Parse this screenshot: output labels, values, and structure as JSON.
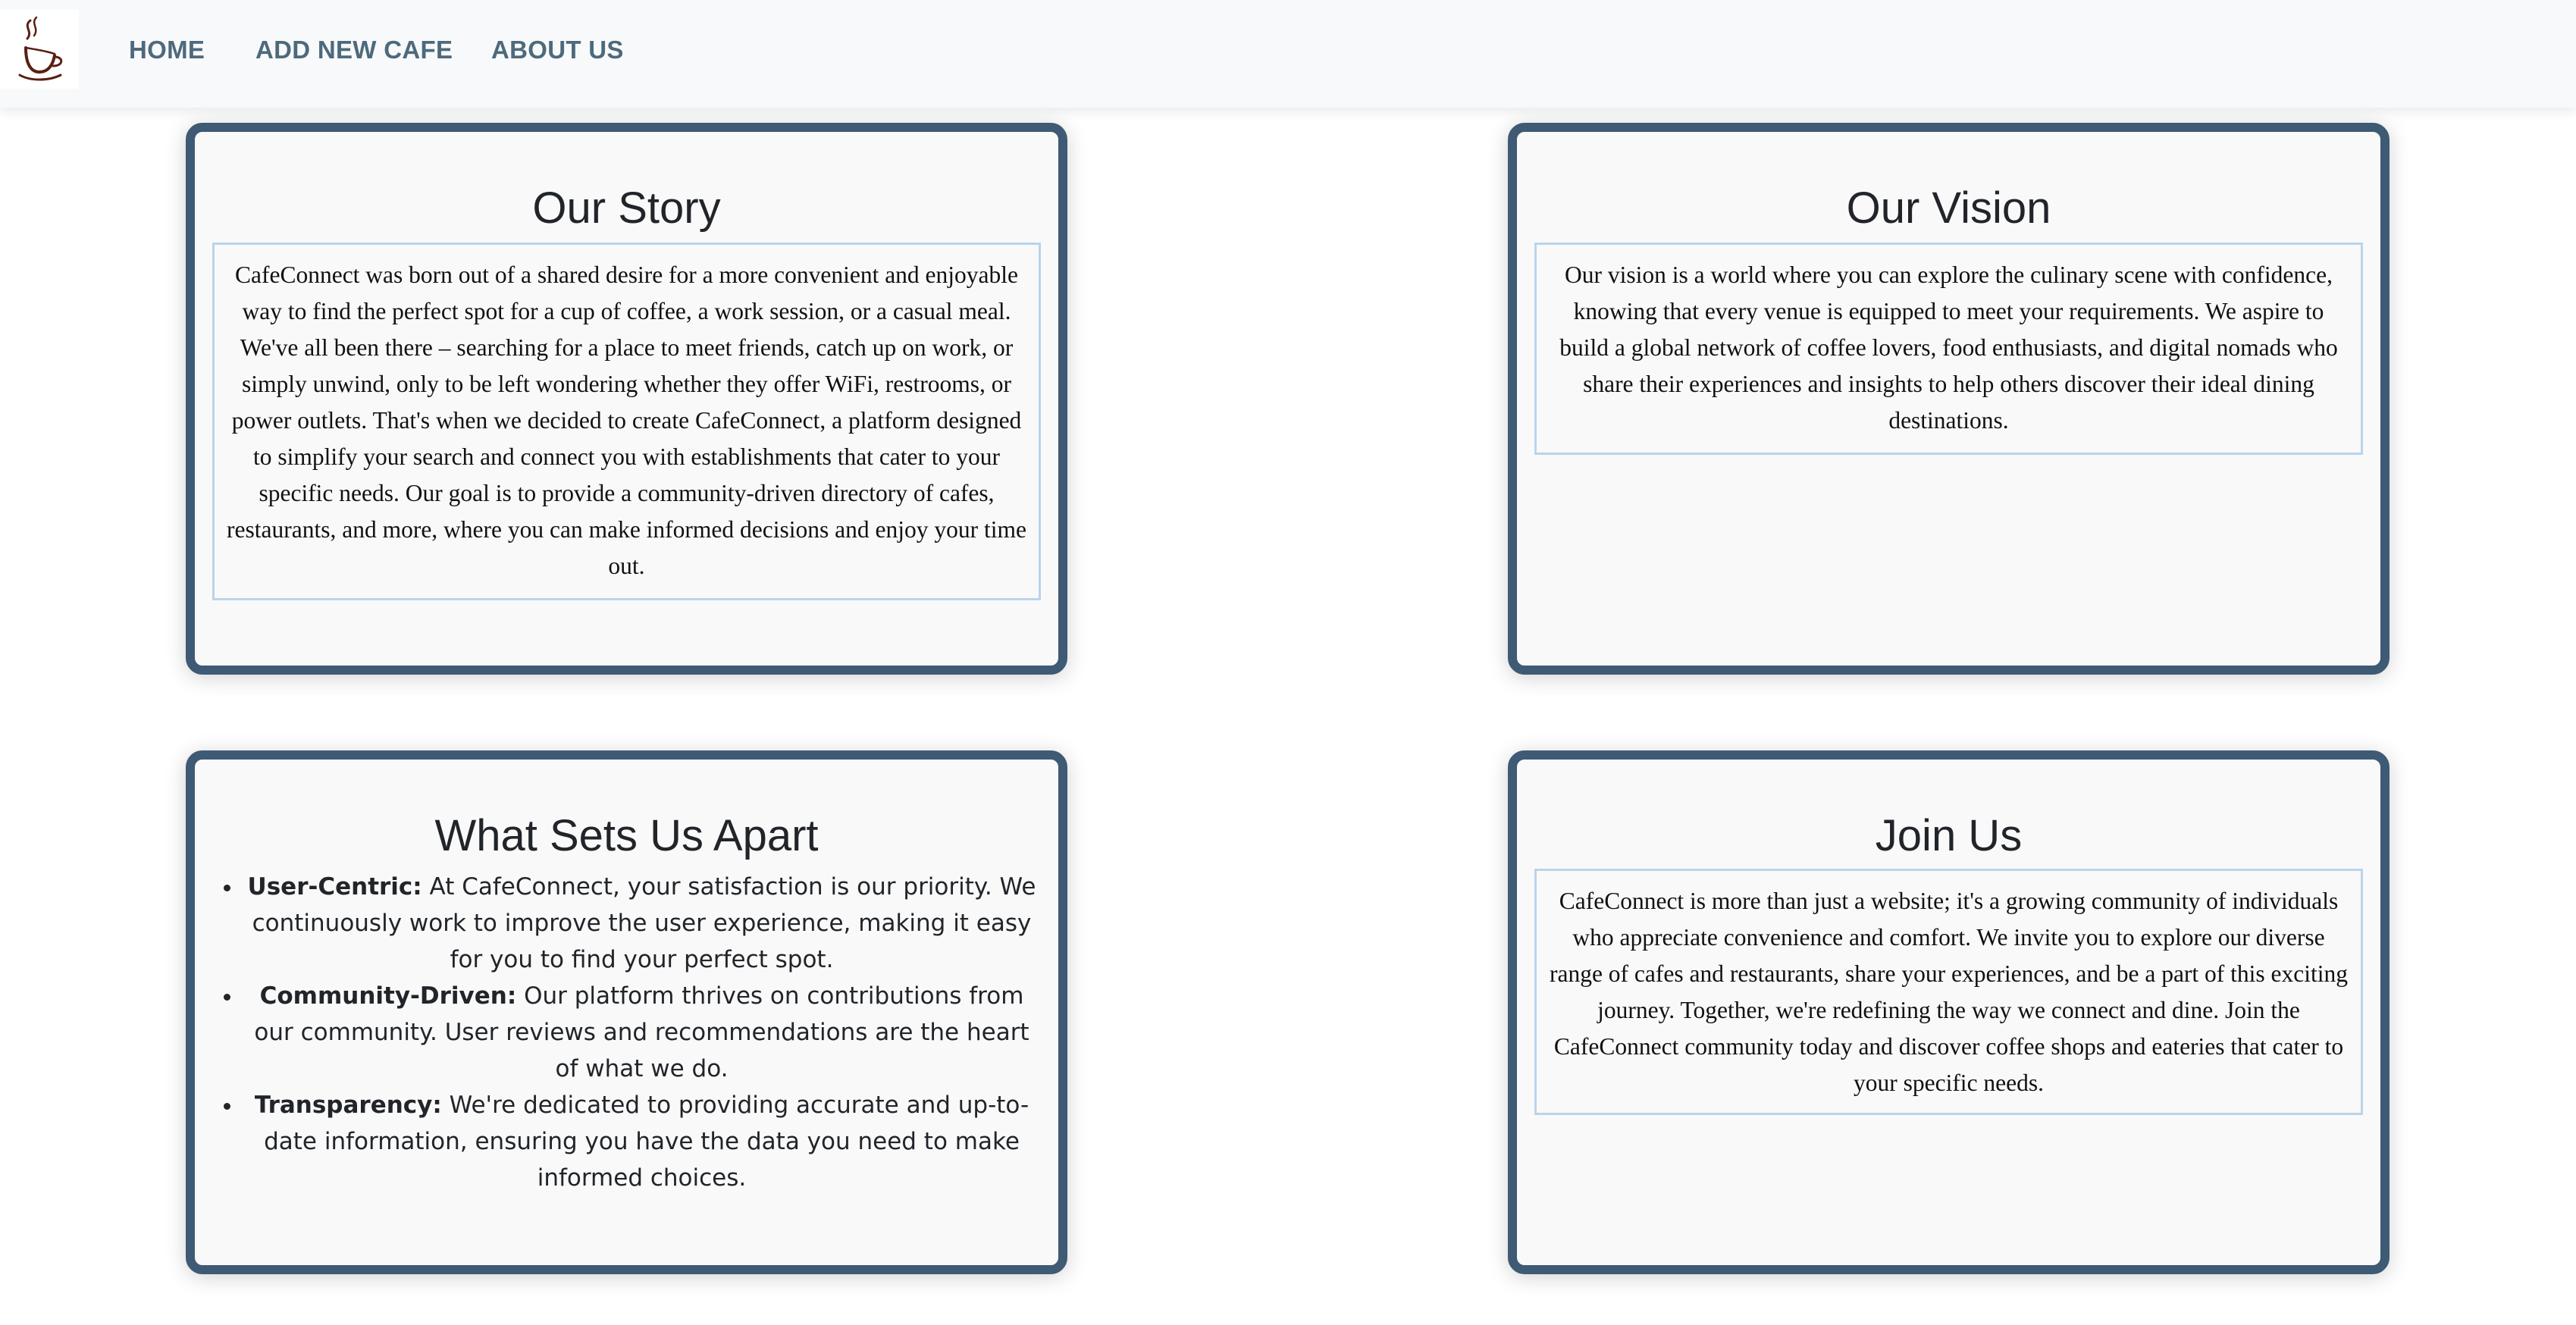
{
  "nav": {
    "logo_alt": "coffee cup logo",
    "links": [
      "HOME",
      "ADD NEW CAFE",
      "ABOUT US"
    ]
  },
  "story": {
    "title": "Our Story",
    "text": "CafeConnect was born out of a shared desire for a more convenient and enjoyable way to find the perfect spot for a cup of coffee, a work session, or a casual meal. We've all been there – searching for a place to meet friends, catch up on work, or simply unwind, only to be left wondering whether they offer WiFi, restrooms, or power outlets. That's when we decided to create CafeConnect, a platform designed to simplify your search and connect you with establishments that cater to your specific needs. Our goal is to provide a community-driven directory of cafes, restaurants, and more, where you can make informed decisions and enjoy your time out."
  },
  "vision": {
    "title": "Our Vision",
    "text": "Our vision is a world where you can explore the culinary scene with confidence, knowing that every venue is equipped to meet your requirements. We aspire to build a global network of coffee lovers, food enthusiasts, and digital nomads who share their experiences and insights to help others discover their ideal dining destinations."
  },
  "apart": {
    "title": "What Sets Us Apart",
    "items": [
      {
        "label": "User-Centric:",
        "text": " At CafeConnect, your satisfaction is our priority. We continuously work to improve the user experience, making it easy for you to find your perfect spot."
      },
      {
        "label": "Community-Driven:",
        "text": " Our platform thrives on contributions from our community. User reviews and recommendations are the heart of what we do."
      },
      {
        "label": "Transparency:",
        "text": " We're dedicated to providing accurate and up-to-date information, ensuring you have the data you need to make informed choices."
      }
    ]
  },
  "join": {
    "title": "Join Us",
    "text": "CafeConnect is more than just a website; it's a growing community of individuals who appreciate convenience and comfort. We invite you to explore our diverse range of cafes and restaurants, share your experiences, and be a part of this exciting journey. Together, we're redefining the way we connect and dine. Join the CafeConnect community today and discover coffee shops and eateries that cater to your specific needs."
  },
  "colors": {
    "navbar_bg": "#f8f9fa",
    "nav_link": "#4d6a7c",
    "card_border": "#3e5a74",
    "textbox_border": "#b9d4ea"
  }
}
